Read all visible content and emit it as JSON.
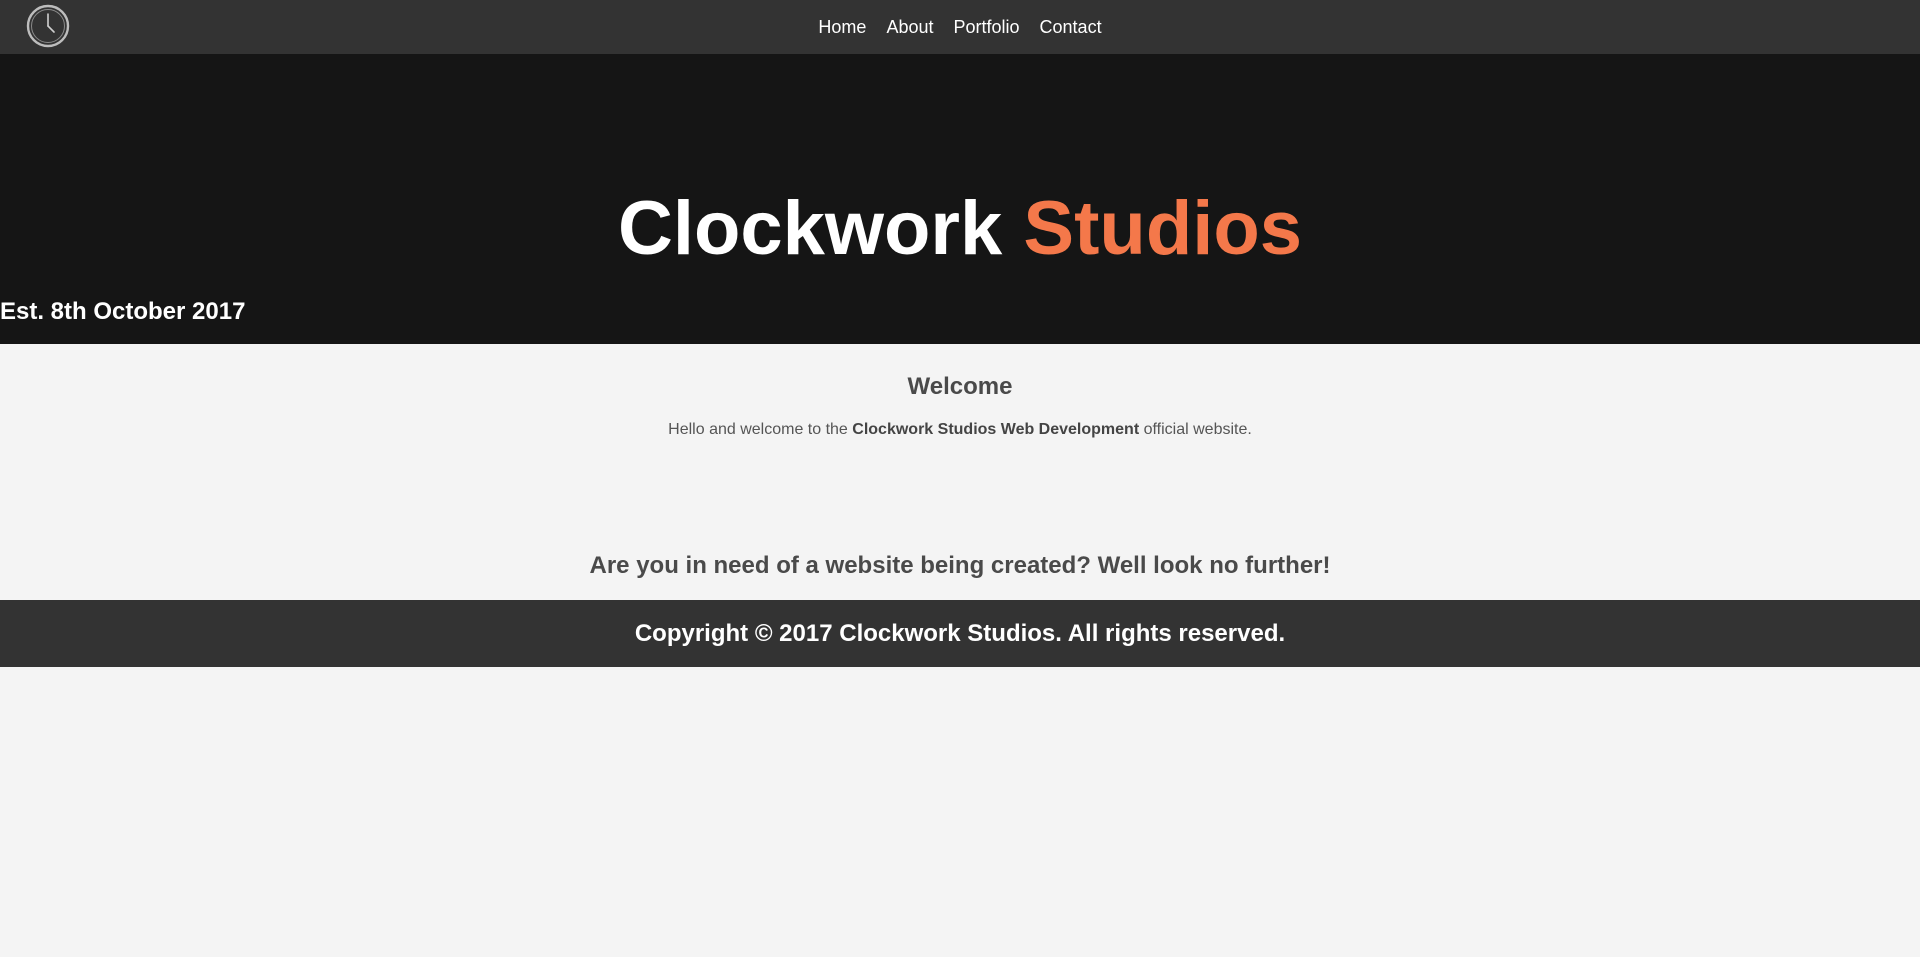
{
  "nav": {
    "logo_icon": "clock-icon",
    "links": [
      "Home",
      "About",
      "Portfolio",
      "Contact"
    ]
  },
  "hero": {
    "title_part1": "Clockwork",
    "title_part2": "Studios",
    "subtitle": "Est. 8th October 2017",
    "accent_color": "#f4784a"
  },
  "main": {
    "heading": "Welcome",
    "text_before": "Hello and welcome to the ",
    "text_bold": "Clockwork Studios Web Development",
    "text_after": " official website.",
    "cta": "Are you in need of a website being created? Well look no further!"
  },
  "footer": {
    "copyright": "Copyright © 2017 Clockwork Studios. All rights reserved."
  }
}
